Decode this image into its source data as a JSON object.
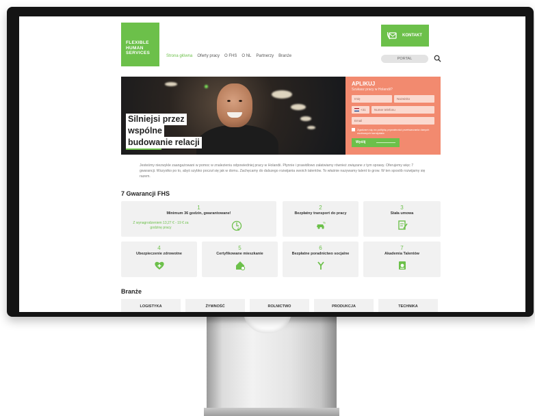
{
  "header": {
    "logo_lines": [
      "FLEXIBLE",
      "HUMAN",
      "SERVICES"
    ],
    "nav": [
      {
        "label": "Strona główna",
        "active": true
      },
      {
        "label": "Oferty pracy",
        "active": false
      },
      {
        "label": "O FHS",
        "active": false
      },
      {
        "label": "O NL",
        "active": false
      },
      {
        "label": "Partnerzy",
        "active": false
      },
      {
        "label": "Branże",
        "active": false
      }
    ],
    "contact_label": "KONTAKT",
    "portal_label": "PORTAL"
  },
  "hero": {
    "lines": [
      "Silniejsi przez",
      "wspólne",
      "budowanie relacji"
    ]
  },
  "apply": {
    "title": "APLIKUJ",
    "subtitle": "Szukasz pracy w Holandii?",
    "first_name_placeholder": "Imię",
    "last_name_placeholder": "Nazwisko",
    "phone_prefix": "+31",
    "phone_placeholder": "Numer telefonu",
    "email_placeholder": "Email",
    "consent": "Zgadzam się na politykę prywatności przetwarzania danych osobowych kandydata",
    "send_label": "Wyślij"
  },
  "intro": "Jesteśmy niezwykle zaangażowani w pomoc w znalezieniu odpowiedniej pracy w Holandii. Płynnie i prawidłowo załatwiamy również związane z tym sprawy. Oferujemy więc 7 gwarancji. Wszystko po to, abyś szybko poczuł się jak w domu. Zachęcamy do dalszego rozwijania swoich talentów. To właśnie nazywamy talent to grow. W ten sposób rozwijamy się razem.",
  "guarantees": {
    "title": "7 Gwarancji FHS",
    "items": [
      {
        "num": "1",
        "label": "Minimum 36 godzin, gwarantowane!",
        "note": "Z wynagrodzeniem 13,27 € - 19 € za godzinę pracy",
        "icon": "euro-clock-icon"
      },
      {
        "num": "2",
        "label": "Bezpłatny transport do pracy",
        "icon": "car-icon"
      },
      {
        "num": "3",
        "label": "Stała umowa",
        "icon": "contract-icon"
      },
      {
        "num": "4",
        "label": "Ubezpieczenie zdrowotne",
        "icon": "heart-plus-icon"
      },
      {
        "num": "5",
        "label": "Certyfikowane mieszkanie",
        "icon": "house-icon"
      },
      {
        "num": "6",
        "label": "Bezpłatne poradnictwo socjalne",
        "icon": "handshake-icon"
      },
      {
        "num": "7",
        "label": "Akademia Talentów",
        "icon": "academy-icon"
      }
    ]
  },
  "branches": {
    "title": "Branże",
    "items": [
      "LOGISTYKA",
      "ŻYWNOŚĆ",
      "ROLNICTWO",
      "PRODUKCJA",
      "TECHNIKA"
    ]
  },
  "colors": {
    "brand_green": "#6cc04a",
    "apply_coral": "#f28a6f",
    "card_grey": "#f1f1f1"
  }
}
